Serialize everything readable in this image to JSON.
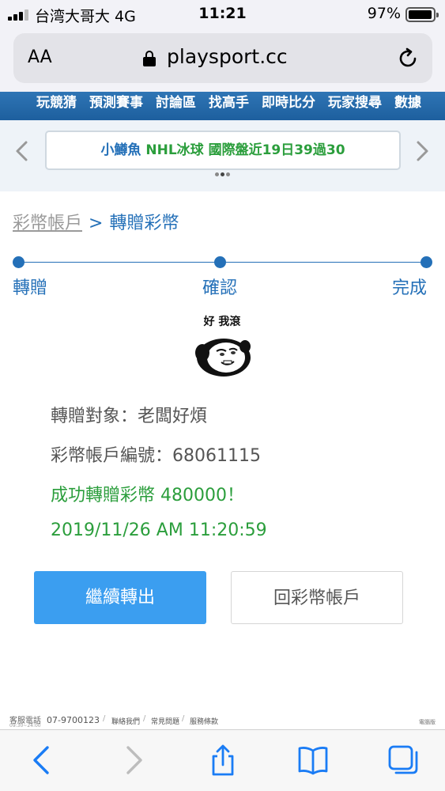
{
  "status_bar": {
    "carrier": "台湾大哥大 4G",
    "time": "11:21",
    "battery": "97%"
  },
  "browser": {
    "text_size_button": "AA",
    "domain": "playsport.cc"
  },
  "site": {
    "nav_items": [
      "玩競猜",
      "預測賽事",
      "討論區",
      "找高手",
      "即時比分",
      "玩家搜尋",
      "數據"
    ],
    "ticker": {
      "player": "小鱒魚",
      "message": "NHL冰球 國際盤近19日39過30"
    }
  },
  "breadcrumb": {
    "parent": "彩幣帳戶",
    "separator": ">",
    "current": "轉贈彩幣"
  },
  "steps": [
    "轉贈",
    "確認",
    "完成"
  ],
  "sticker": {
    "caption": "好 我滾",
    "icon": "panda-meme-sticker"
  },
  "result": {
    "recipient_label": "轉贈對象：",
    "recipient": "老闆好煩",
    "account_label": "彩幣帳戶編號：",
    "account_number": "68061115",
    "success_message": "成功轉贈彩幣 480000！",
    "timestamp": "2019/11/26 AM 11:20:59"
  },
  "buttons": {
    "continue": "繼續轉出",
    "back_to_account": "回彩幣帳戶"
  },
  "footer": {
    "service_label": "客服電話",
    "service_hours": "09:30~24:00",
    "phone": "07-9700123",
    "links": [
      "聯絡我們",
      "常見問題",
      "服務條款"
    ],
    "right_link": "電腦版"
  },
  "toolbar_icons": [
    "back-icon",
    "forward-icon",
    "share-icon",
    "bookmarks-icon",
    "tabs-icon"
  ],
  "colors": {
    "accent_blue": "#2470b8",
    "success_green": "#2b9e3c",
    "primary_button": "#3b9ef0",
    "safari_blue": "#1a7cf5"
  }
}
